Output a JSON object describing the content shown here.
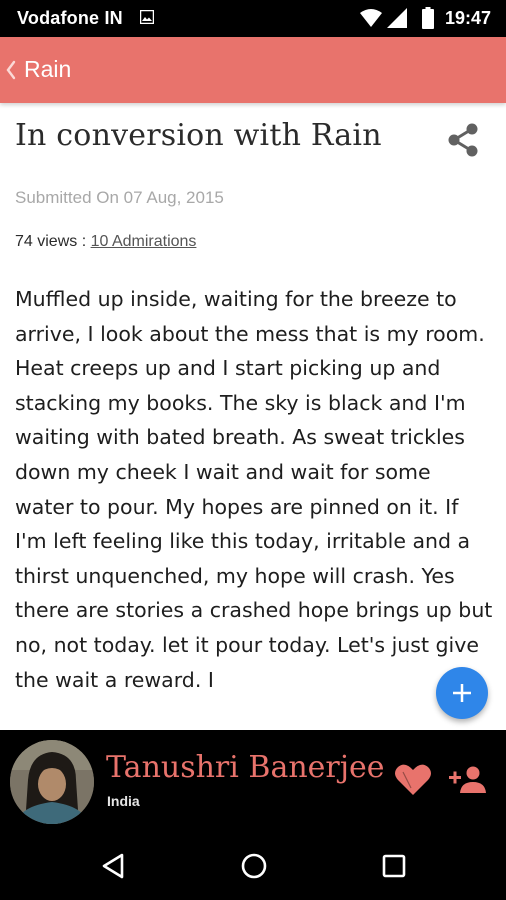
{
  "status_bar": {
    "carrier": "Vodafone IN",
    "time": "19:47",
    "icons": [
      "gallery-icon",
      "wifi-icon",
      "signal-icon",
      "battery-icon"
    ]
  },
  "app_bar": {
    "back_icon": "chevron-left-icon",
    "title": "Rain",
    "color": "#e8736c"
  },
  "post": {
    "title": "In conversion with Rain",
    "share_icon": "share-icon",
    "submitted": "Submitted On 07 Aug, 2015",
    "views": "74 views : ",
    "admirations": "10 Admirations",
    "body": "Muffled up inside, waiting for the breeze to arrive, I look about the mess that is my room. Heat creeps up and I start picking up and stacking my books.  The sky is black and I'm waiting with bated breath. As sweat trickles down my cheek I wait and wait for some water to pour. My hopes are pinned on it. If I'm left feeling like this today,  irritable and a thirst unquenched, my hope will crash. Yes there are stories a crashed hope brings up but no, not today.  let it pour today. Let's just give the wait a reward. I"
  },
  "fab": {
    "icon": "plus-icon",
    "color": "#2f86e9"
  },
  "author": {
    "name": "Tanushri Banerjee",
    "country": "India",
    "name_color": "#e8736c",
    "actions": [
      "heart-icon",
      "add-user-icon"
    ]
  },
  "nav_bar": {
    "icons": [
      "back-triangle-icon",
      "home-circle-icon",
      "recents-square-icon"
    ]
  }
}
